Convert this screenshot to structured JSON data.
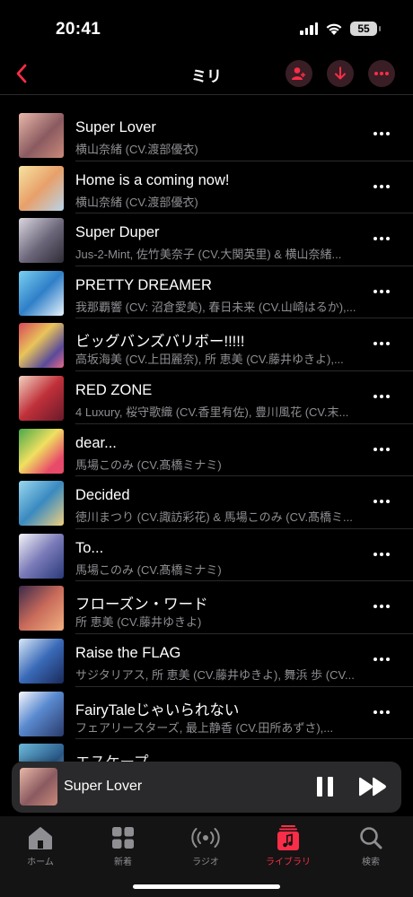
{
  "status_bar": {
    "time": "20:41",
    "battery": "55"
  },
  "nav": {
    "title": "ミリ"
  },
  "colors": {
    "accent": "#fa2d48",
    "background": "#000000",
    "secondary_text": "#8e8e93"
  },
  "songs": [
    {
      "title": "Super Lover",
      "artist": "横山奈緒 (CV.渡部優衣)"
    },
    {
      "title": "Home is a coming now!",
      "artist": "横山奈緒 (CV.渡部優衣)"
    },
    {
      "title": "Super Duper",
      "artist": "Jus-2-Mint, 佐竹美奈子 (CV.大関英里) & 横山奈緒..."
    },
    {
      "title": "PRETTY DREAMER",
      "artist": "我那覇響 (CV: 沼倉愛美), 春日未来 (CV.山崎はるか),..."
    },
    {
      "title": "ビッグバンズバリボー!!!!!",
      "artist": "高坂海美 (CV.上田麗奈), 所 恵美 (CV.藤井ゆきよ),..."
    },
    {
      "title": "RED ZONE",
      "artist": "4 Luxury, 桜守歌織 (CV.香里有佐), 豊川風花 (CV.末..."
    },
    {
      "title": "dear...",
      "artist": "馬場このみ (CV.髙橋ミナミ)"
    },
    {
      "title": "Decided",
      "artist": "徳川まつり (CV.諏訪彩花) & 馬場このみ (CV.髙橋ミ..."
    },
    {
      "title": "To...",
      "artist": "馬場このみ (CV.髙橋ミナミ)"
    },
    {
      "title": "フローズン・ワード",
      "artist": "所 恵美 (CV.藤井ゆきよ)"
    },
    {
      "title": "Raise the FLAG",
      "artist": "サジタリアス, 所 恵美 (CV.藤井ゆきよ), 舞浜 歩 (CV..."
    },
    {
      "title": "FairyTaleじゃいられない",
      "artist": "フェアリースターズ, 最上静香 (CV.田所あずさ),..."
    },
    {
      "title": "エスケープ",
      "artist": ""
    }
  ],
  "now_playing": {
    "title": "Super Lover"
  },
  "tabs": [
    {
      "label": "ホーム",
      "icon": "home-icon"
    },
    {
      "label": "新着",
      "icon": "grid-icon"
    },
    {
      "label": "ラジオ",
      "icon": "radio-icon"
    },
    {
      "label": "ライブラリ",
      "icon": "library-icon"
    },
    {
      "label": "検索",
      "icon": "search-icon"
    }
  ]
}
